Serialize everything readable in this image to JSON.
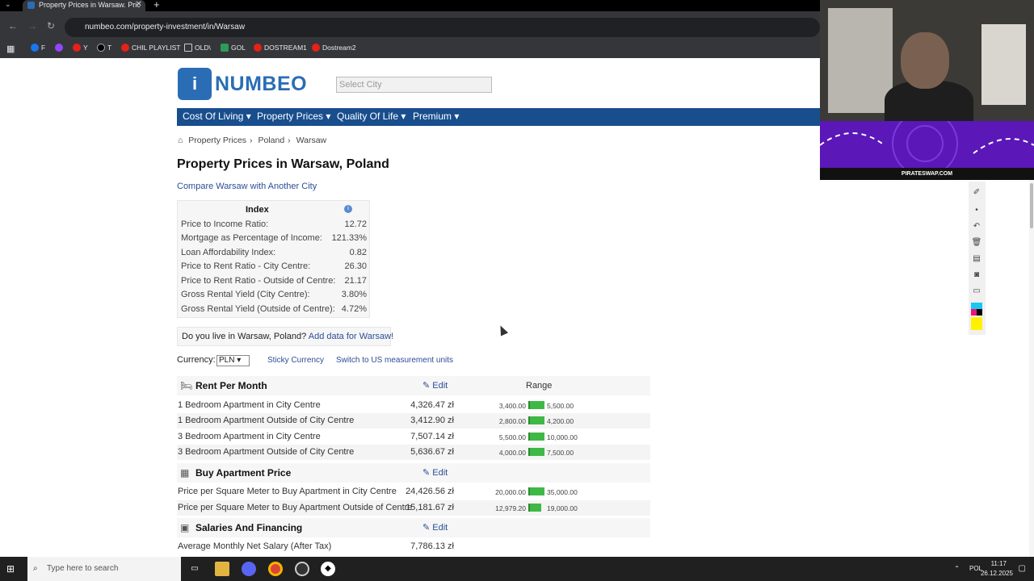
{
  "browser": {
    "tab_title": "Property Prices in Warsaw. Pric",
    "url": "numbeo.com/property-investment/in/Warsaw",
    "bookmarks": [
      "F",
      "Y",
      "T",
      "CHIL PLAYLIST",
      "OLD\\",
      "GOL",
      "DOSTREAM1",
      "Dostream2"
    ]
  },
  "site": {
    "logo": "NUMBEO",
    "city_placeholder": "Select City",
    "nav": [
      "Cost Of Living ▾",
      "Property Prices ▾",
      "Quality Of Life ▾",
      "Premium ▾"
    ]
  },
  "breadcrumb": [
    "Property Prices",
    "Poland",
    "Warsaw"
  ],
  "page_title": "Property Prices in Warsaw, Poland",
  "compare_link": "Compare Warsaw with Another City",
  "index": {
    "heading": "Index",
    "rows": [
      {
        "label": "Price to Income Ratio:",
        "value": "12.72"
      },
      {
        "label": "Mortgage as Percentage of Income:",
        "value": "121.33%"
      },
      {
        "label": "Loan Affordability Index:",
        "value": "0.82"
      },
      {
        "label": "Price to Rent Ratio - City Centre:",
        "value": "26.30"
      },
      {
        "label": "Price to Rent Ratio - Outside of Centre:",
        "value": "21.17"
      },
      {
        "label": "Gross Rental Yield (City Centre):",
        "value": "3.80%"
      },
      {
        "label": "Gross Rental Yield (Outside of Centre):",
        "value": "4.72%"
      }
    ]
  },
  "contribute": {
    "text": "Do you live in Warsaw, Poland?",
    "link": "Add data for Warsaw!"
  },
  "currency": {
    "label": "Currency:",
    "value": "PLN",
    "sticky": "Sticky Currency",
    "switch": "Switch to US measurement units"
  },
  "sections": {
    "rent": {
      "title": "Rent Per Month",
      "edit": "Edit",
      "range": "Range",
      "rows": [
        {
          "label": "1 Bedroom Apartment in City Centre",
          "value": "4,326.47 zł",
          "low": "3,400.00",
          "high": "5,500.00"
        },
        {
          "label": "1 Bedroom Apartment Outside of City Centre",
          "value": "3,412.90 zł",
          "low": "2,800.00",
          "high": "4,200.00"
        },
        {
          "label": "3 Bedroom Apartment in City Centre",
          "value": "7,507.14 zł",
          "low": "5,500.00",
          "high": "10,000.00"
        },
        {
          "label": "3 Bedroom Apartment Outside of City Centre",
          "value": "5,636.67 zł",
          "low": "4,000.00",
          "high": "7,500.00"
        }
      ]
    },
    "buy": {
      "title": "Buy Apartment Price",
      "edit": "Edit",
      "rows": [
        {
          "label": "Price per Square Meter to Buy Apartment in City Centre",
          "value": "24,426.56 zł",
          "low": "20,000.00",
          "high": "35,000.00"
        },
        {
          "label": "Price per Square Meter to Buy Apartment Outside of Centre",
          "value": "15,181.67 zł",
          "low": "12,979.20",
          "high": "19,000.00"
        }
      ]
    },
    "salaries": {
      "title": "Salaries And Financing",
      "edit": "Edit",
      "rows": [
        {
          "label": "Average Monthly Net Salary (After Tax)",
          "value": "7,786.13 zł"
        }
      ]
    }
  },
  "overlay": {
    "banner_text": "PIRATESWAP.COM"
  },
  "taskbar": {
    "search_placeholder": "Type here to search",
    "lang": "POL",
    "time": "11:17",
    "date": "26.12.2025"
  }
}
